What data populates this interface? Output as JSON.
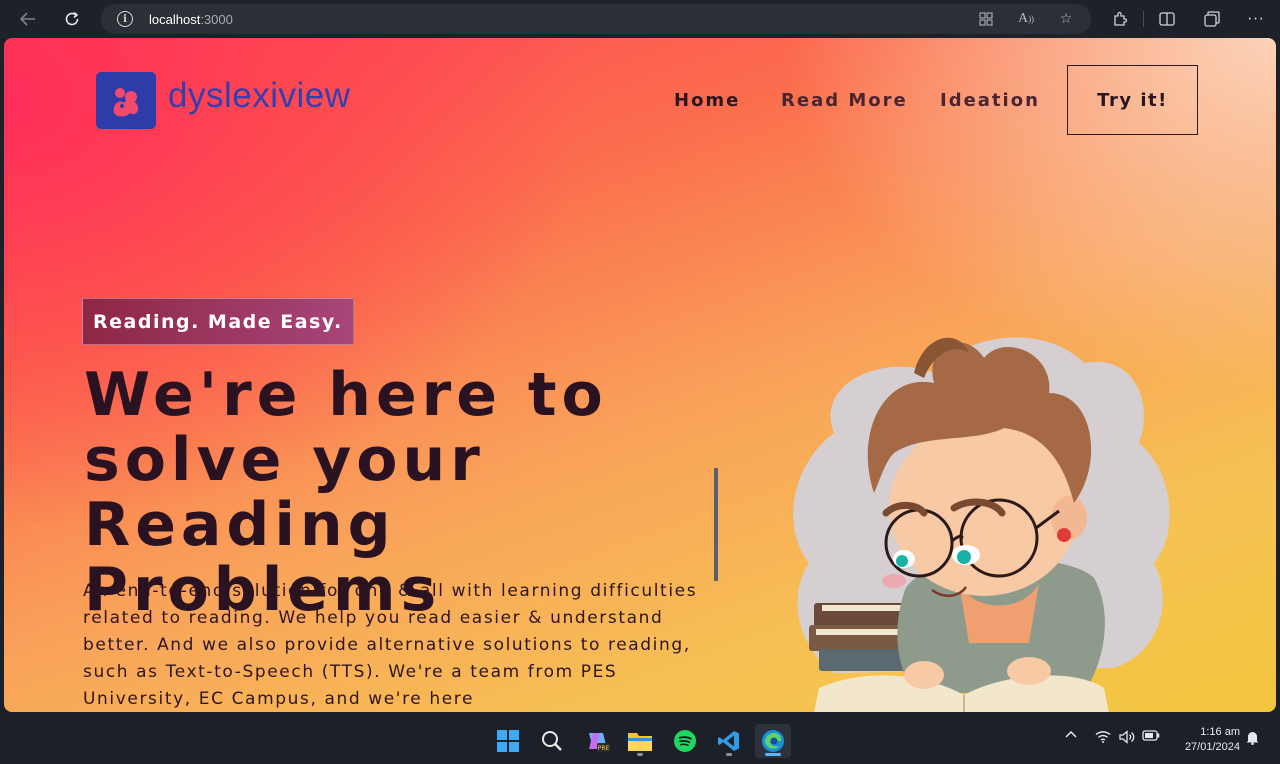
{
  "browser": {
    "url_host": "localhost",
    "url_port": ":3000"
  },
  "site": {
    "brand": "dyslexiview",
    "nav": [
      "Home",
      "Read More",
      "Ideation"
    ],
    "cta": "Try it!"
  },
  "hero": {
    "tagline": "Reading. Made Easy.",
    "headline_line1": "We're here to",
    "headline_line2": "solve your",
    "headline_line3": "Reading Problems",
    "description": "An end-to-end solution for one & all with learning difficulties related to reading. We help you read easier & understand better. And we also provide alternative solutions to reading, such as Text-to-Speech (TTS). We're a team from PES University, EC Campus, and we're here"
  },
  "taskbar": {
    "time": "1:16 am",
    "date": "27/01/2024"
  },
  "colors": {
    "brand_blue": "#3340b0",
    "text_dark": "#2a1220",
    "tagline_bg": "#8e2745"
  }
}
